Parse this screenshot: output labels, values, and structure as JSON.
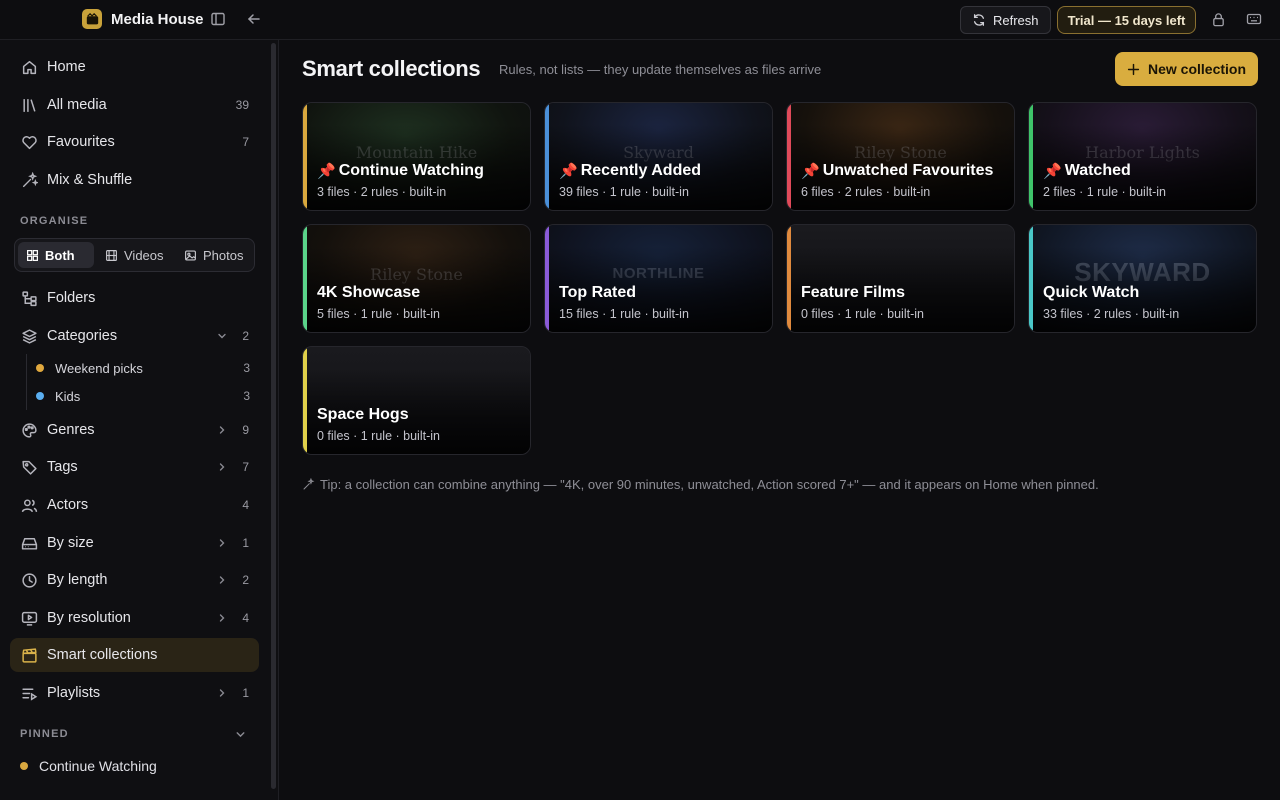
{
  "app": {
    "title": "Media House"
  },
  "topbar": {
    "refresh_label": "Refresh",
    "trial_label": "Trial — 15 days left"
  },
  "sidebar": {
    "nav": [
      {
        "label": "Home",
        "count": ""
      },
      {
        "label": "All media",
        "count": "39"
      },
      {
        "label": "Favourites",
        "count": "7"
      },
      {
        "label": "Mix & Shuffle",
        "count": ""
      }
    ],
    "organise_label": "ORGANISE",
    "filter": {
      "both": "Both",
      "videos": "Videos",
      "photos": "Photos",
      "selected": "Both"
    },
    "organise": [
      {
        "label": "Folders",
        "count": ""
      },
      {
        "label": "Categories",
        "count": "2"
      }
    ],
    "categories": [
      {
        "label": "Weekend picks",
        "count": "3",
        "color": "#e0a83e"
      },
      {
        "label": "Kids",
        "count": "3",
        "color": "#5aaef0"
      }
    ],
    "more": [
      {
        "label": "Genres",
        "count": "9"
      },
      {
        "label": "Tags",
        "count": "7"
      },
      {
        "label": "Actors",
        "count": "4"
      },
      {
        "label": "By size",
        "count": "1"
      },
      {
        "label": "By length",
        "count": "2"
      },
      {
        "label": "By resolution",
        "count": "4"
      },
      {
        "label": "Smart collections",
        "count": ""
      },
      {
        "label": "Playlists",
        "count": "1"
      }
    ],
    "pinned_label": "PINNED",
    "pinned": [
      {
        "label": "Continue Watching"
      }
    ]
  },
  "main": {
    "title": "Smart collections",
    "subtitle": "Rules, not lists — they update themselves as files arrive",
    "new_button": "New collection",
    "cards": [
      {
        "title": "Continue Watching",
        "meta": "3 files · 2 rules · built-in",
        "pinned": true,
        "accent": "#d9a83e",
        "ghost": "Mountain Hike"
      },
      {
        "title": "Recently Added",
        "meta": "39 files · 1 rule · built-in",
        "pinned": true,
        "accent": "#4a8fd8",
        "ghost": "Skyward"
      },
      {
        "title": "Unwatched Favourites",
        "meta": "6 files · 2 rules · built-in",
        "pinned": true,
        "accent": "#e04a5a",
        "ghost": "Riley Stone"
      },
      {
        "title": "Watched",
        "meta": "2 files · 1 rule · built-in",
        "pinned": true,
        "accent": "#3fc46a",
        "ghost": "Harbor Lights"
      },
      {
        "title": "4K Showcase",
        "meta": "5 files · 1 rule · built-in",
        "pinned": false,
        "accent": "#5ad48a",
        "ghost": "Riley Stone"
      },
      {
        "title": "Top Rated",
        "meta": "15 files · 1 rule · built-in",
        "pinned": false,
        "accent": "#8a5ad8",
        "ghost": "NORTHLINE"
      },
      {
        "title": "Feature Films",
        "meta": "0 files · 1 rule · built-in",
        "pinned": false,
        "accent": "#e08a3e",
        "ghost": ""
      },
      {
        "title": "Quick Watch",
        "meta": "33 files · 2 rules · built-in",
        "pinned": false,
        "accent": "#4ac8c8",
        "ghost": "SKYWARD"
      },
      {
        "title": "Space Hogs",
        "meta": "0 files · 1 rule · built-in",
        "pinned": false,
        "accent": "#e0d04a",
        "ghost": ""
      }
    ],
    "tip": "Tip: a collection can combine anything — \"4K, over 90 minutes, unwatched, Action scored 7+\" — and it appears on Home when pinned."
  },
  "colors": {
    "accent": "#d9ad3f",
    "active_bg": "#2a2416"
  }
}
